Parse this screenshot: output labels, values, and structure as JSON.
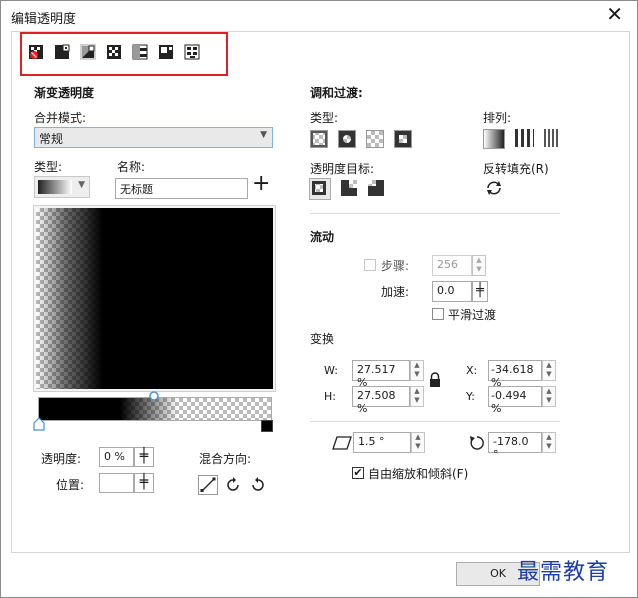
{
  "window": {
    "title": "编辑透明度",
    "close_glyph": "✕"
  },
  "modes": [
    "no-transparency-icon",
    "uniform-transparency-icon",
    "linear-transparency-icon",
    "fountain-transparency-icon",
    "two-color-pattern-icon",
    "bitmap-pattern-icon",
    "texture-transparency-icon"
  ],
  "left": {
    "section_title": "渐变透明度",
    "merge_label": "合并模式:",
    "merge_value": "常规",
    "type_label": "类型:",
    "name_label": "名称:",
    "name_value": "无标题",
    "add_glyph": "+",
    "opacity_label": "透明度:",
    "opacity_value": "0 %",
    "position_label": "位置:",
    "position_value": "",
    "blend_dir_label": "混合方向:"
  },
  "right": {
    "section_title": "调和过渡:",
    "type_label": "类型:",
    "arrange_label": "排列:",
    "target_label": "透明度目标:",
    "reverse_label": "反转填充(R)",
    "flow_title": "流动",
    "steps_label": "步骤:",
    "steps_value": "256",
    "accel_label": "加速:",
    "accel_value": "0.0",
    "smooth_label": "平滑过渡",
    "transform_title": "变换",
    "w_label": "W:",
    "w_value": "27.517 %",
    "h_label": "H:",
    "h_value": "27.508 %",
    "x_label": "X:",
    "x_value": "-34.618 %",
    "y_label": "Y:",
    "y_value": "-0.494 %",
    "skew_value": "1.5 °",
    "rotate_value": "-178.0 °",
    "free_scale_label": "自由缩放和倾斜(F)",
    "free_scale_checked": true
  },
  "footer": {
    "ok_label": "OK"
  },
  "watermark": "最需教育",
  "colors": {
    "accent_red": "#e31e25",
    "watermark_blue": "#1c3ea6"
  }
}
